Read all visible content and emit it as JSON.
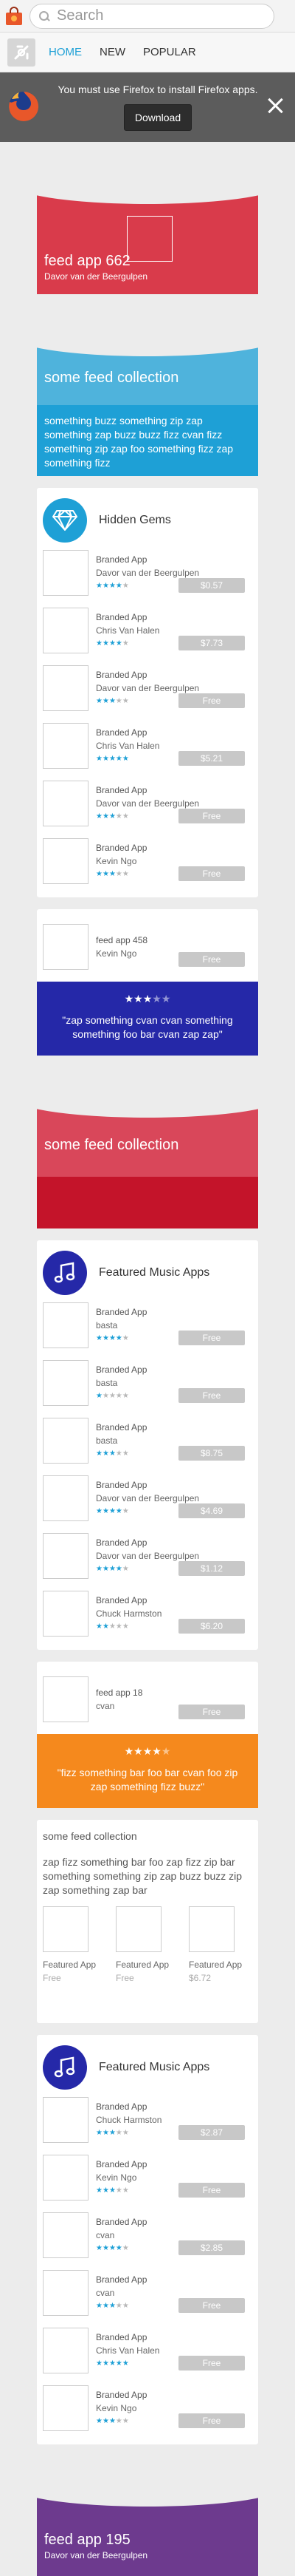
{
  "header": {
    "search_placeholder": "Search"
  },
  "nav": {
    "tabs": [
      {
        "label": "HOME",
        "active": true
      },
      {
        "label": "NEW",
        "active": false
      },
      {
        "label": "POPULAR",
        "active": false
      }
    ]
  },
  "banner": {
    "message": "You must use Firefox to install Firefox apps.",
    "button": "Download"
  },
  "feed_app_1": {
    "title": "feed app 662",
    "author": "Davor van der Beergulpen"
  },
  "collection_blue": {
    "title": "some feed collection",
    "description": "something buzz something zip zap something zap buzz buzz fizz cvan fizz something zip zap foo something fizz zap something fizz"
  },
  "hidden_gems": {
    "title": "Hidden Gems",
    "icon": "diamond-icon",
    "color": "#1ea0d6",
    "items": [
      {
        "name": "Branded App",
        "author": "Davor van der Beergulpen",
        "rating": 4,
        "price": "$0.57"
      },
      {
        "name": "Branded App",
        "author": "Chris Van Halen",
        "rating": 4,
        "price": "$7.73"
      },
      {
        "name": "Branded App",
        "author": "Davor van der Beergulpen",
        "rating": 3,
        "price": "Free"
      },
      {
        "name": "Branded App",
        "author": "Chris Van Halen",
        "rating": 5,
        "price": "$5.21"
      },
      {
        "name": "Branded App",
        "author": "Davor van der Beergulpen",
        "rating": 3,
        "price": "Free"
      },
      {
        "name": "Branded App",
        "author": "Kevin Ngo",
        "rating": 3,
        "price": "Free"
      }
    ]
  },
  "single_app_1": {
    "name": "feed app 458",
    "author": "Kevin Ngo",
    "price": "Free"
  },
  "quote_blue": {
    "rating": 3,
    "text": "\"zap something cvan cvan something something foo bar cvan zap zap\""
  },
  "collection_red": {
    "title": "some feed collection"
  },
  "music_1": {
    "title": "Featured Music Apps",
    "icon": "music-note-icon",
    "color": "#2528a8",
    "items": [
      {
        "name": "Branded App",
        "author": "basta",
        "rating": 4,
        "price": "Free"
      },
      {
        "name": "Branded App",
        "author": "basta",
        "rating": 1,
        "price": "Free"
      },
      {
        "name": "Branded App",
        "author": "basta",
        "rating": 3,
        "price": "$8.75"
      },
      {
        "name": "Branded App",
        "author": "Davor van der Beergulpen",
        "rating": 4,
        "price": "$4.69"
      },
      {
        "name": "Branded App",
        "author": "Davor van der Beergulpen",
        "rating": 4,
        "price": "$1.12"
      },
      {
        "name": "Branded App",
        "author": "Chuck Harmston",
        "rating": 2,
        "price": "$6.20"
      }
    ]
  },
  "single_app_2": {
    "name": "feed app 18",
    "author": "cvan",
    "price": "Free"
  },
  "quote_orange": {
    "rating": 4,
    "text": "\"fizz something bar foo bar cvan foo zip zap something fizz buzz\""
  },
  "grid_collection": {
    "title": "some feed collection",
    "description": "zap fizz something bar foo zap fizz zip bar something something zip zap buzz buzz zip zap something zap bar",
    "items": [
      {
        "name": "Featured App",
        "price": "Free"
      },
      {
        "name": "Featured App",
        "price": "Free"
      },
      {
        "name": "Featured App",
        "price": "$6.72"
      }
    ]
  },
  "music_2": {
    "title": "Featured Music Apps",
    "icon": "music-note-icon",
    "color": "#2528a8",
    "items": [
      {
        "name": "Branded App",
        "author": "Chuck Harmston",
        "rating": 3,
        "price": "$2.87"
      },
      {
        "name": "Branded App",
        "author": "Kevin Ngo",
        "rating": 3,
        "price": "Free"
      },
      {
        "name": "Branded App",
        "author": "cvan",
        "rating": 4,
        "price": "$2.85"
      },
      {
        "name": "Branded App",
        "author": "cvan",
        "rating": 3,
        "price": "Free"
      },
      {
        "name": "Branded App",
        "author": "Chris Van Halen",
        "rating": 5,
        "price": "Free"
      },
      {
        "name": "Branded App",
        "author": "Kevin Ngo",
        "rating": 3,
        "price": "Free"
      }
    ]
  },
  "feed_app_2": {
    "title": "feed app 195",
    "author": "Davor van der Beergulpen"
  }
}
